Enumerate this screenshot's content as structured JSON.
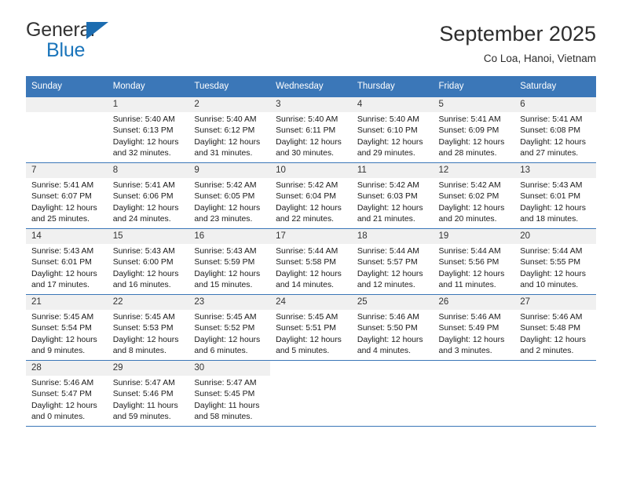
{
  "logo": {
    "general": "General",
    "blue": "Blue",
    "triangle_color": "#1b6cb0"
  },
  "header": {
    "title": "September 2025",
    "subtitle": "Co Loa, Hanoi, Vietnam"
  },
  "theme": {
    "header_row_bg": "#3b77b8",
    "daynum_bg": "#f0f0f0",
    "grid_line": "#3b77b8"
  },
  "weekdays": [
    "Sunday",
    "Monday",
    "Tuesday",
    "Wednesday",
    "Thursday",
    "Friday",
    "Saturday"
  ],
  "weeks": [
    [
      {
        "blank": true
      },
      {
        "day": "1",
        "sunrise": "Sunrise: 5:40 AM",
        "sunset": "Sunset: 6:13 PM",
        "daylight1": "Daylight: 12 hours",
        "daylight2": "and 32 minutes."
      },
      {
        "day": "2",
        "sunrise": "Sunrise: 5:40 AM",
        "sunset": "Sunset: 6:12 PM",
        "daylight1": "Daylight: 12 hours",
        "daylight2": "and 31 minutes."
      },
      {
        "day": "3",
        "sunrise": "Sunrise: 5:40 AM",
        "sunset": "Sunset: 6:11 PM",
        "daylight1": "Daylight: 12 hours",
        "daylight2": "and 30 minutes."
      },
      {
        "day": "4",
        "sunrise": "Sunrise: 5:40 AM",
        "sunset": "Sunset: 6:10 PM",
        "daylight1": "Daylight: 12 hours",
        "daylight2": "and 29 minutes."
      },
      {
        "day": "5",
        "sunrise": "Sunrise: 5:41 AM",
        "sunset": "Sunset: 6:09 PM",
        "daylight1": "Daylight: 12 hours",
        "daylight2": "and 28 minutes."
      },
      {
        "day": "6",
        "sunrise": "Sunrise: 5:41 AM",
        "sunset": "Sunset: 6:08 PM",
        "daylight1": "Daylight: 12 hours",
        "daylight2": "and 27 minutes."
      }
    ],
    [
      {
        "day": "7",
        "sunrise": "Sunrise: 5:41 AM",
        "sunset": "Sunset: 6:07 PM",
        "daylight1": "Daylight: 12 hours",
        "daylight2": "and 25 minutes."
      },
      {
        "day": "8",
        "sunrise": "Sunrise: 5:41 AM",
        "sunset": "Sunset: 6:06 PM",
        "daylight1": "Daylight: 12 hours",
        "daylight2": "and 24 minutes."
      },
      {
        "day": "9",
        "sunrise": "Sunrise: 5:42 AM",
        "sunset": "Sunset: 6:05 PM",
        "daylight1": "Daylight: 12 hours",
        "daylight2": "and 23 minutes."
      },
      {
        "day": "10",
        "sunrise": "Sunrise: 5:42 AM",
        "sunset": "Sunset: 6:04 PM",
        "daylight1": "Daylight: 12 hours",
        "daylight2": "and 22 minutes."
      },
      {
        "day": "11",
        "sunrise": "Sunrise: 5:42 AM",
        "sunset": "Sunset: 6:03 PM",
        "daylight1": "Daylight: 12 hours",
        "daylight2": "and 21 minutes."
      },
      {
        "day": "12",
        "sunrise": "Sunrise: 5:42 AM",
        "sunset": "Sunset: 6:02 PM",
        "daylight1": "Daylight: 12 hours",
        "daylight2": "and 20 minutes."
      },
      {
        "day": "13",
        "sunrise": "Sunrise: 5:43 AM",
        "sunset": "Sunset: 6:01 PM",
        "daylight1": "Daylight: 12 hours",
        "daylight2": "and 18 minutes."
      }
    ],
    [
      {
        "day": "14",
        "sunrise": "Sunrise: 5:43 AM",
        "sunset": "Sunset: 6:01 PM",
        "daylight1": "Daylight: 12 hours",
        "daylight2": "and 17 minutes."
      },
      {
        "day": "15",
        "sunrise": "Sunrise: 5:43 AM",
        "sunset": "Sunset: 6:00 PM",
        "daylight1": "Daylight: 12 hours",
        "daylight2": "and 16 minutes."
      },
      {
        "day": "16",
        "sunrise": "Sunrise: 5:43 AM",
        "sunset": "Sunset: 5:59 PM",
        "daylight1": "Daylight: 12 hours",
        "daylight2": "and 15 minutes."
      },
      {
        "day": "17",
        "sunrise": "Sunrise: 5:44 AM",
        "sunset": "Sunset: 5:58 PM",
        "daylight1": "Daylight: 12 hours",
        "daylight2": "and 14 minutes."
      },
      {
        "day": "18",
        "sunrise": "Sunrise: 5:44 AM",
        "sunset": "Sunset: 5:57 PM",
        "daylight1": "Daylight: 12 hours",
        "daylight2": "and 12 minutes."
      },
      {
        "day": "19",
        "sunrise": "Sunrise: 5:44 AM",
        "sunset": "Sunset: 5:56 PM",
        "daylight1": "Daylight: 12 hours",
        "daylight2": "and 11 minutes."
      },
      {
        "day": "20",
        "sunrise": "Sunrise: 5:44 AM",
        "sunset": "Sunset: 5:55 PM",
        "daylight1": "Daylight: 12 hours",
        "daylight2": "and 10 minutes."
      }
    ],
    [
      {
        "day": "21",
        "sunrise": "Sunrise: 5:45 AM",
        "sunset": "Sunset: 5:54 PM",
        "daylight1": "Daylight: 12 hours",
        "daylight2": "and 9 minutes."
      },
      {
        "day": "22",
        "sunrise": "Sunrise: 5:45 AM",
        "sunset": "Sunset: 5:53 PM",
        "daylight1": "Daylight: 12 hours",
        "daylight2": "and 8 minutes."
      },
      {
        "day": "23",
        "sunrise": "Sunrise: 5:45 AM",
        "sunset": "Sunset: 5:52 PM",
        "daylight1": "Daylight: 12 hours",
        "daylight2": "and 6 minutes."
      },
      {
        "day": "24",
        "sunrise": "Sunrise: 5:45 AM",
        "sunset": "Sunset: 5:51 PM",
        "daylight1": "Daylight: 12 hours",
        "daylight2": "and 5 minutes."
      },
      {
        "day": "25",
        "sunrise": "Sunrise: 5:46 AM",
        "sunset": "Sunset: 5:50 PM",
        "daylight1": "Daylight: 12 hours",
        "daylight2": "and 4 minutes."
      },
      {
        "day": "26",
        "sunrise": "Sunrise: 5:46 AM",
        "sunset": "Sunset: 5:49 PM",
        "daylight1": "Daylight: 12 hours",
        "daylight2": "and 3 minutes."
      },
      {
        "day": "27",
        "sunrise": "Sunrise: 5:46 AM",
        "sunset": "Sunset: 5:48 PM",
        "daylight1": "Daylight: 12 hours",
        "daylight2": "and 2 minutes."
      }
    ],
    [
      {
        "day": "28",
        "sunrise": "Sunrise: 5:46 AM",
        "sunset": "Sunset: 5:47 PM",
        "daylight1": "Daylight: 12 hours",
        "daylight2": "and 0 minutes."
      },
      {
        "day": "29",
        "sunrise": "Sunrise: 5:47 AM",
        "sunset": "Sunset: 5:46 PM",
        "daylight1": "Daylight: 11 hours",
        "daylight2": "and 59 minutes."
      },
      {
        "day": "30",
        "sunrise": "Sunrise: 5:47 AM",
        "sunset": "Sunset: 5:45 PM",
        "daylight1": "Daylight: 11 hours",
        "daylight2": "and 58 minutes."
      },
      {
        "empty": true
      },
      {
        "empty": true
      },
      {
        "empty": true
      },
      {
        "empty": true
      }
    ]
  ]
}
